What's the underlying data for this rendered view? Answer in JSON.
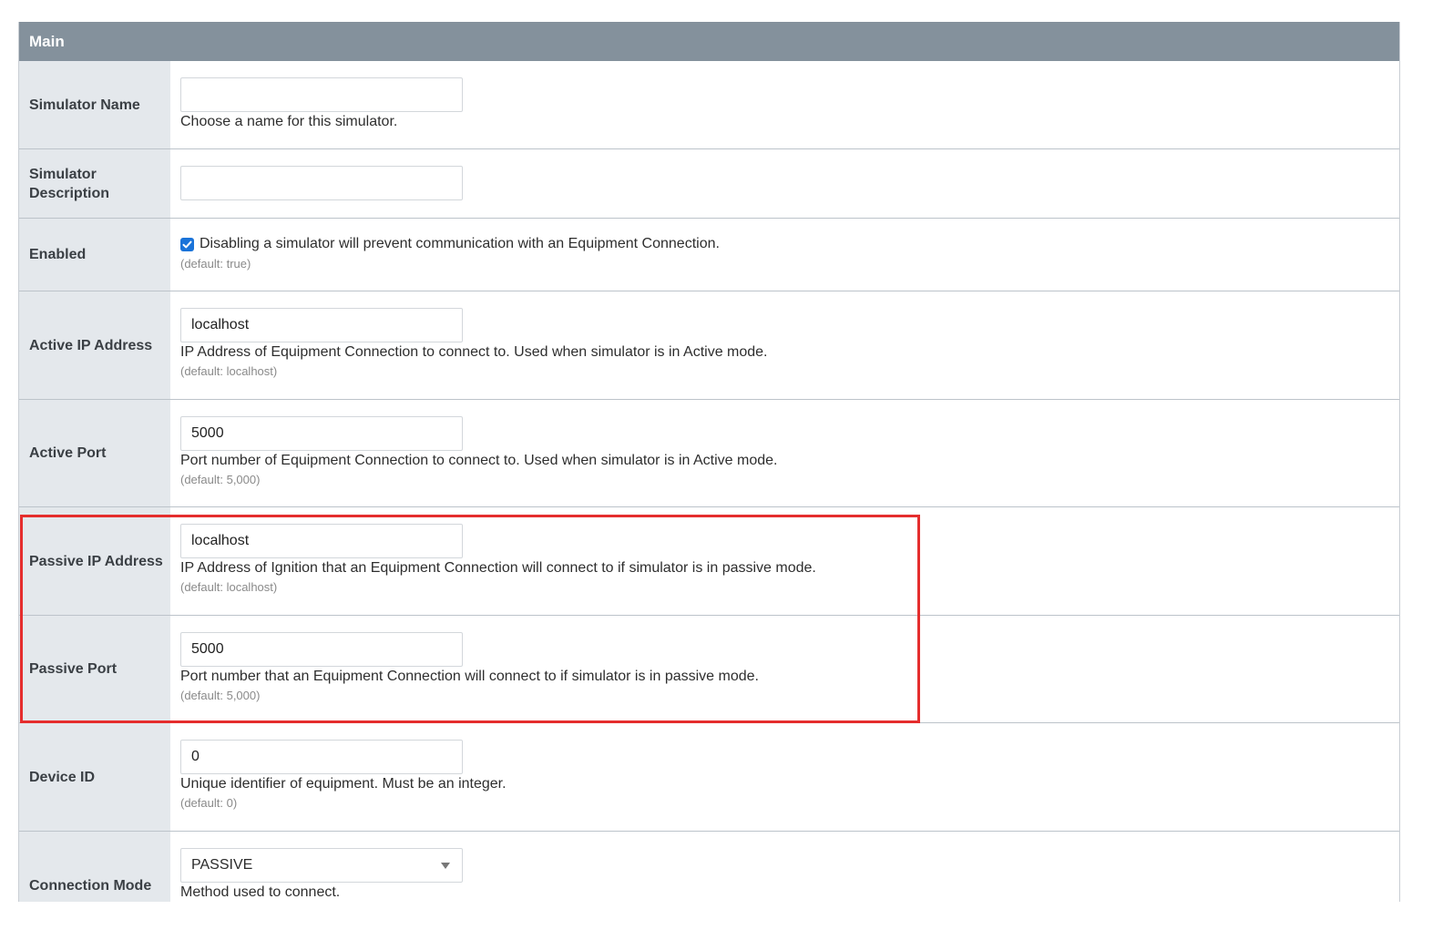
{
  "panel": {
    "title": "Main"
  },
  "fields": {
    "simulator_name": {
      "label": "Simulator Name",
      "value": "",
      "help": "Choose a name for this simulator."
    },
    "simulator_description": {
      "label": "Simulator Description",
      "value": ""
    },
    "enabled": {
      "label": "Enabled",
      "checked": true,
      "help": "Disabling a simulator will prevent communication with an Equipment Connection.",
      "default": "(default: true)"
    },
    "active_ip": {
      "label": "Active IP Address",
      "value": "localhost",
      "help": "IP Address of Equipment Connection to connect to. Used when simulator is in Active mode.",
      "default": "(default: localhost)"
    },
    "active_port": {
      "label": "Active Port",
      "value": "5000",
      "help": "Port number of Equipment Connection to connect to. Used when simulator is in Active mode.",
      "default": "(default: 5,000)"
    },
    "passive_ip": {
      "label": "Passive IP Address",
      "value": "localhost",
      "help": "IP Address of Ignition that an Equipment Connection will connect to if simulator is in passive mode.",
      "default": "(default: localhost)"
    },
    "passive_port": {
      "label": "Passive Port",
      "value": "5000",
      "help": "Port number that an Equipment Connection will connect to if simulator is in passive mode.",
      "default": "(default: 5,000)"
    },
    "device_id": {
      "label": "Device ID",
      "value": "0",
      "help": "Unique identifier of equipment. Must be an integer.",
      "default": "(default: 0)"
    },
    "connection_mode": {
      "label": "Connection Mode",
      "value": "PASSIVE",
      "help": "Method used to connect."
    }
  },
  "colors": {
    "header_bg": "#84919c",
    "label_bg": "#e4e8ec",
    "checkbox": "#1a73d9",
    "highlight": "#e52d2d"
  },
  "icons": {
    "checkbox": "check-icon",
    "select": "chevron-down-icon"
  }
}
